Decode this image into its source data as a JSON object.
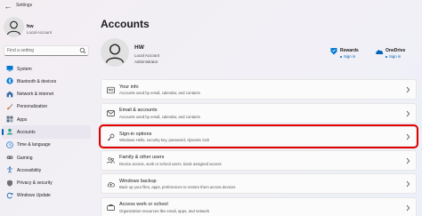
{
  "window": {
    "title": "Settings",
    "back_glyph": "←"
  },
  "sidebar": {
    "user": {
      "name": "hw",
      "account": "Local Account"
    },
    "search": {
      "placeholder": "Find a setting"
    },
    "items": [
      {
        "label": "System",
        "icon": "monitor-icon",
        "color": "#0078d4"
      },
      {
        "label": "Bluetooth & devices",
        "icon": "bluetooth-icon",
        "color": "#0078d4"
      },
      {
        "label": "Network & internet",
        "icon": "wifi-icon",
        "color": "#3a6ea5"
      },
      {
        "label": "Personalization",
        "icon": "paintbrush-icon",
        "color": "#d67b2d"
      },
      {
        "label": "Apps",
        "icon": "apps-icon",
        "color": "#5b6b7d"
      },
      {
        "label": "Accounts",
        "icon": "person-icon",
        "color": "#2fa37e",
        "active": true
      },
      {
        "label": "Time & language",
        "icon": "globe-clock-icon",
        "color": "#1f7bd0"
      },
      {
        "label": "Gaming",
        "icon": "controller-icon",
        "color": "#6f6f6f"
      },
      {
        "label": "Accessibility",
        "icon": "accessibility-icon",
        "color": "#1f6fb6"
      },
      {
        "label": "Privacy & security",
        "icon": "shield-icon",
        "color": "#6f6f6f"
      },
      {
        "label": "Windows Update",
        "icon": "update-icon",
        "color": "#1f6fb6"
      }
    ]
  },
  "main": {
    "title": "Accounts",
    "account": {
      "name": "HW",
      "type": "Local Account",
      "role": "Administrator"
    },
    "rewards": {
      "title": "Rewards",
      "link": "Sign in"
    },
    "onedrive": {
      "title": "OneDrive",
      "link": "Sign in"
    },
    "cards": [
      {
        "title": "Your info",
        "desc": "Accounts used by email, calendar, and contacts",
        "icon": "person-card-icon"
      },
      {
        "title": "Email & accounts",
        "desc": "Accounts used by email, calendar, and contacts",
        "icon": "mail-icon"
      },
      {
        "title": "Sign-in options",
        "desc": "Windows Hello, security key, password, dynamic lock",
        "icon": "key-icon",
        "highlighted": true
      },
      {
        "title": "Family & other users",
        "desc": "Device access, work or school users, kiosk assigned access",
        "icon": "family-icon"
      },
      {
        "title": "Windows backup",
        "desc": "Back up your files, apps, preferences to restore them across devices",
        "icon": "backup-icon"
      },
      {
        "title": "Access work or school",
        "desc": "Organization resources like email, apps, and network",
        "icon": "briefcase-icon"
      }
    ]
  },
  "colors": {
    "accent": "#005fb8",
    "highlight": "#e00000"
  }
}
